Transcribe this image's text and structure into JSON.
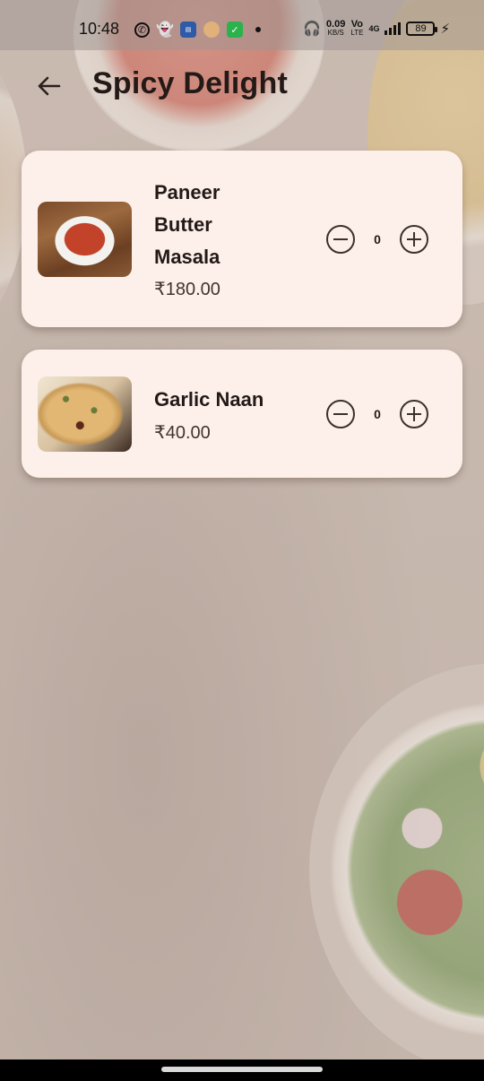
{
  "status_bar": {
    "time": "10:48",
    "network_speed": "0.09",
    "network_unit": "KB/S",
    "volte_top": "Vo",
    "volte_bottom": "LTE",
    "network_type": "4G",
    "battery": "89"
  },
  "header": {
    "title": "Spicy Delight"
  },
  "menu_items": [
    {
      "name": "Paneer Butter Masala",
      "price": "₹180.00",
      "quantity": "0",
      "image": "paneer-dish-image"
    },
    {
      "name": "Garlic Naan",
      "price": "₹40.00",
      "quantity": "0",
      "image": "garlic-naan-image"
    }
  ],
  "colors": {
    "card_background": "#fdf0ea",
    "text_primary": "#231a17",
    "page_background": "#cbbcb3"
  }
}
